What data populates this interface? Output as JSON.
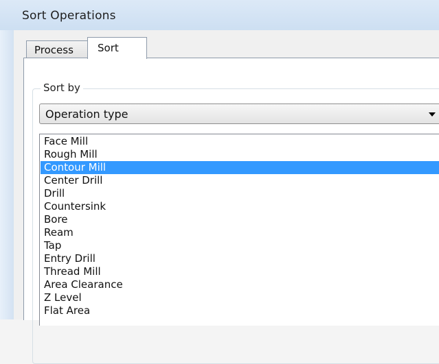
{
  "window": {
    "title": "Sort Operations"
  },
  "tabs": [
    {
      "label": "Process",
      "active": false
    },
    {
      "label": "Sort",
      "active": true
    }
  ],
  "sort_by": {
    "label": "Sort by",
    "selected": "Operation type"
  },
  "operation_list": {
    "selected_index": 2,
    "items": [
      "Face Mill",
      "Rough Mill",
      "Contour Mill",
      "Center Drill",
      "Drill",
      "Countersink",
      "Bore",
      "Ream",
      "Tap",
      "Entry Drill",
      "Thread Mill",
      "Area Clearance",
      "Z Level",
      "Flat Area"
    ]
  },
  "colors": {
    "selection": "#3399ff",
    "titlebar": "#dce9f7"
  }
}
